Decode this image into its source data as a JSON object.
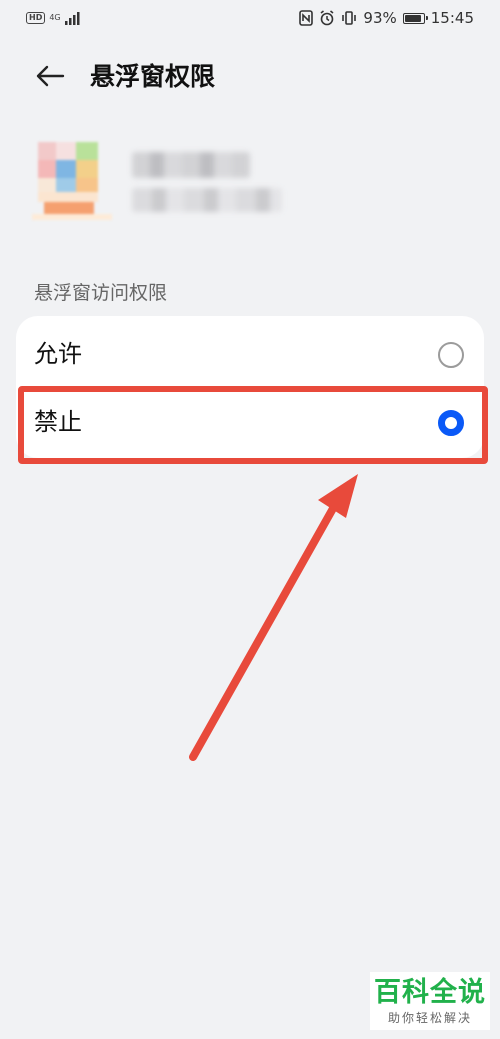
{
  "status_bar": {
    "left_badge": "HD",
    "network_type": "4G",
    "battery_percent": "93%",
    "time": "15:45",
    "battery_level": 0.93,
    "icons": [
      "signal-icon",
      "nfc-icon",
      "alarm-icon",
      "vibrate-icon",
      "battery-icon"
    ]
  },
  "header": {
    "back_icon": "arrow-left-icon",
    "title": "悬浮窗权限"
  },
  "section": {
    "label": "悬浮窗访问权限"
  },
  "options": [
    {
      "label": "允许",
      "selected": false
    },
    {
      "label": "禁止",
      "selected": true
    }
  ],
  "colors": {
    "accent": "#0a59f7",
    "highlight": "#e84a3b",
    "background": "#f1f2f4",
    "watermark_green": "#21b14b"
  },
  "watermark": {
    "title": "百科全说",
    "subtitle": "助你轻松解决"
  }
}
